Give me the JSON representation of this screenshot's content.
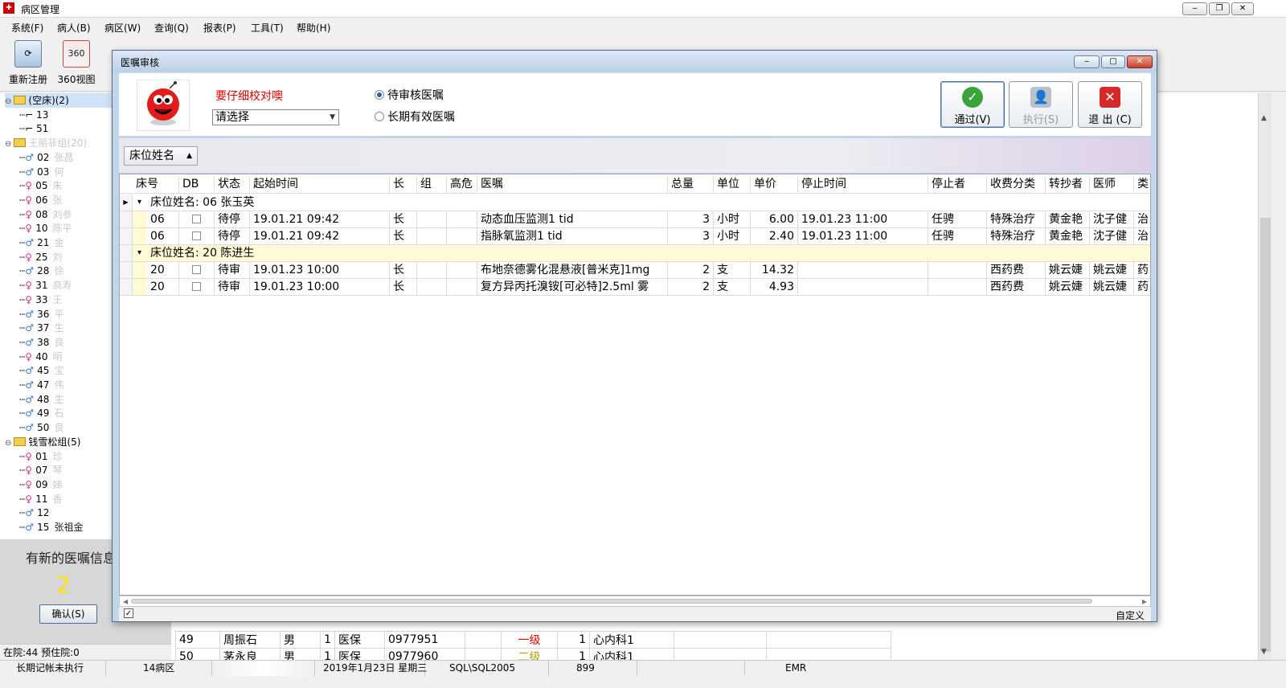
{
  "window": {
    "title": "病区管理",
    "icon": "hospital-app-icon"
  },
  "menu": [
    "系统(F)",
    "病人(B)",
    "病区(W)",
    "查询(Q)",
    "报表(P)",
    "工具(T)",
    "帮助(H)"
  ],
  "toolbar": [
    {
      "label": "重新注册",
      "icon": "register-icon"
    },
    {
      "label": "360视图",
      "icon": "calendar-360-icon",
      "icon_text": "360"
    }
  ],
  "tree": {
    "groups": [
      {
        "label": "(空床)(2)",
        "beds": [
          "13",
          "51"
        ]
      },
      {
        "label": "王丽菲组(20)",
        "beds": [
          {
            "bed": "02",
            "sex": "m",
            "name": "张昌"
          },
          {
            "bed": "03",
            "sex": "m",
            "name": "何"
          },
          {
            "bed": "05",
            "sex": "f",
            "name": "朱"
          },
          {
            "bed": "06",
            "sex": "f",
            "name": "张"
          },
          {
            "bed": "08",
            "sex": "f",
            "name": "刘参"
          },
          {
            "bed": "10",
            "sex": "f",
            "name": "陈平"
          },
          {
            "bed": "21",
            "sex": "m",
            "name": "金"
          },
          {
            "bed": "25",
            "sex": "f",
            "name": "刘"
          },
          {
            "bed": "28",
            "sex": "m",
            "name": "徐"
          },
          {
            "bed": "31",
            "sex": "f",
            "name": "高寿"
          },
          {
            "bed": "33",
            "sex": "f",
            "name": "王"
          },
          {
            "bed": "36",
            "sex": "m",
            "name": "平"
          },
          {
            "bed": "37",
            "sex": "m",
            "name": "生"
          },
          {
            "bed": "38",
            "sex": "m",
            "name": "良"
          },
          {
            "bed": "40",
            "sex": "f",
            "name": "明"
          },
          {
            "bed": "45",
            "sex": "m",
            "name": "宝"
          },
          {
            "bed": "47",
            "sex": "m",
            "name": "伟"
          },
          {
            "bed": "48",
            "sex": "m",
            "name": "生"
          },
          {
            "bed": "49",
            "sex": "m",
            "name": "石"
          },
          {
            "bed": "50",
            "sex": "m",
            "name": "良"
          }
        ]
      },
      {
        "label": "钱雪松组(5)",
        "beds": [
          {
            "bed": "01",
            "sex": "f",
            "name": "珍"
          },
          {
            "bed": "07",
            "sex": "f",
            "name": "琴"
          },
          {
            "bed": "09",
            "sex": "f",
            "name": "娣"
          },
          {
            "bed": "11",
            "sex": "f",
            "name": "香"
          },
          {
            "bed": "12",
            "sex": "m",
            "name": ""
          },
          {
            "bed": "15",
            "sex": "m",
            "name": "张祖金"
          }
        ]
      }
    ]
  },
  "notice": {
    "message": "有新的医嘱信息",
    "count": "2",
    "confirm_label": "确认(S)"
  },
  "census": "在院:44 预住院:0",
  "background_rows": [
    {
      "bed": "49",
      "name": "周振石",
      "sex": "男",
      "n": "1",
      "insurance": "医保",
      "id": "0977951",
      "level": "一级",
      "level_color": "#e00000",
      "qty": "1",
      "dept": "心内科1"
    },
    {
      "bed": "50",
      "name": "茅永良",
      "sex": "男",
      "n": "1",
      "insurance": "医保",
      "id": "0977960",
      "level": "二级",
      "level_color": "#b0a000",
      "qty": "1",
      "dept": "心内科1"
    }
  ],
  "statusbar": [
    "长期记帐未执行",
    "14病区",
    "",
    "2019年1月23日 星期三",
    "SQL\\SQL2005",
    "899",
    "",
    "EMR"
  ],
  "dialog": {
    "title": "医嘱审核",
    "warning": "要仔细校对噢",
    "select_value": "请选择",
    "radios": [
      {
        "label": "待审核医嘱",
        "checked": true
      },
      {
        "label": "长期有效医嘱",
        "checked": false
      }
    ],
    "buttons": [
      {
        "label": "通过(V)",
        "icon": "check-icon",
        "enabled": true
      },
      {
        "label": "执行(S)",
        "icon": "execute-person-icon",
        "enabled": false
      },
      {
        "label": "退 出 (C)",
        "icon": "exit-x-icon",
        "enabled": true
      }
    ],
    "group_chip": "床位姓名",
    "columns": [
      "床号",
      "DB",
      "状态",
      "起始时间",
      "长",
      "组",
      "高危",
      "医嘱",
      "总量",
      "单位",
      "单价",
      "停止时间",
      "停止者",
      "收费分类",
      "转抄者",
      "医师",
      "类"
    ],
    "groups": [
      {
        "label": "床位姓名: 06   张玉英",
        "highlight": false,
        "rows": [
          {
            "bed": "06",
            "status": "待停",
            "start": "19.01.21 09:42",
            "long": "长",
            "order": "动态血压监测1  tid",
            "total": "3",
            "unit": "小时",
            "price": "6.00",
            "stop_time": "19.01.23 11:00",
            "stopper": "任骋",
            "fee_class": "特殊治疗",
            "copier": "黄金艳",
            "doctor": "沈子健",
            "type": "治"
          },
          {
            "bed": "06",
            "status": "待停",
            "start": "19.01.21 09:42",
            "long": "长",
            "order": "指脉氧监测1  tid",
            "total": "3",
            "unit": "小时",
            "price": "2.40",
            "stop_time": "19.01.23 11:00",
            "stopper": "任骋",
            "fee_class": "特殊治疗",
            "copier": "黄金艳",
            "doctor": "沈子健",
            "type": "治"
          }
        ]
      },
      {
        "label": "床位姓名: 20   陈进生",
        "highlight": true,
        "rows": [
          {
            "bed": "20",
            "status": "待审",
            "start": "19.01.23 10:00",
            "long": "长",
            "order": "布地奈德雾化混悬液[普米克]1mg",
            "total": "2",
            "unit": "支",
            "price": "14.32",
            "stop_time": "",
            "stopper": "",
            "fee_class": "西药费",
            "copier": "姚云婕",
            "doctor": "姚云婕",
            "type": "药"
          },
          {
            "bed": "20",
            "status": "待审",
            "start": "19.01.23 10:00",
            "long": "长",
            "order": "复方异丙托溴铵[可必特]2.5ml 雾",
            "total": "2",
            "unit": "支",
            "price": "4.93",
            "stop_time": "",
            "stopper": "",
            "fee_class": "西药费",
            "copier": "姚云婕",
            "doctor": "姚云婕",
            "type": "药"
          }
        ]
      }
    ],
    "footer_custom": "自定义"
  }
}
